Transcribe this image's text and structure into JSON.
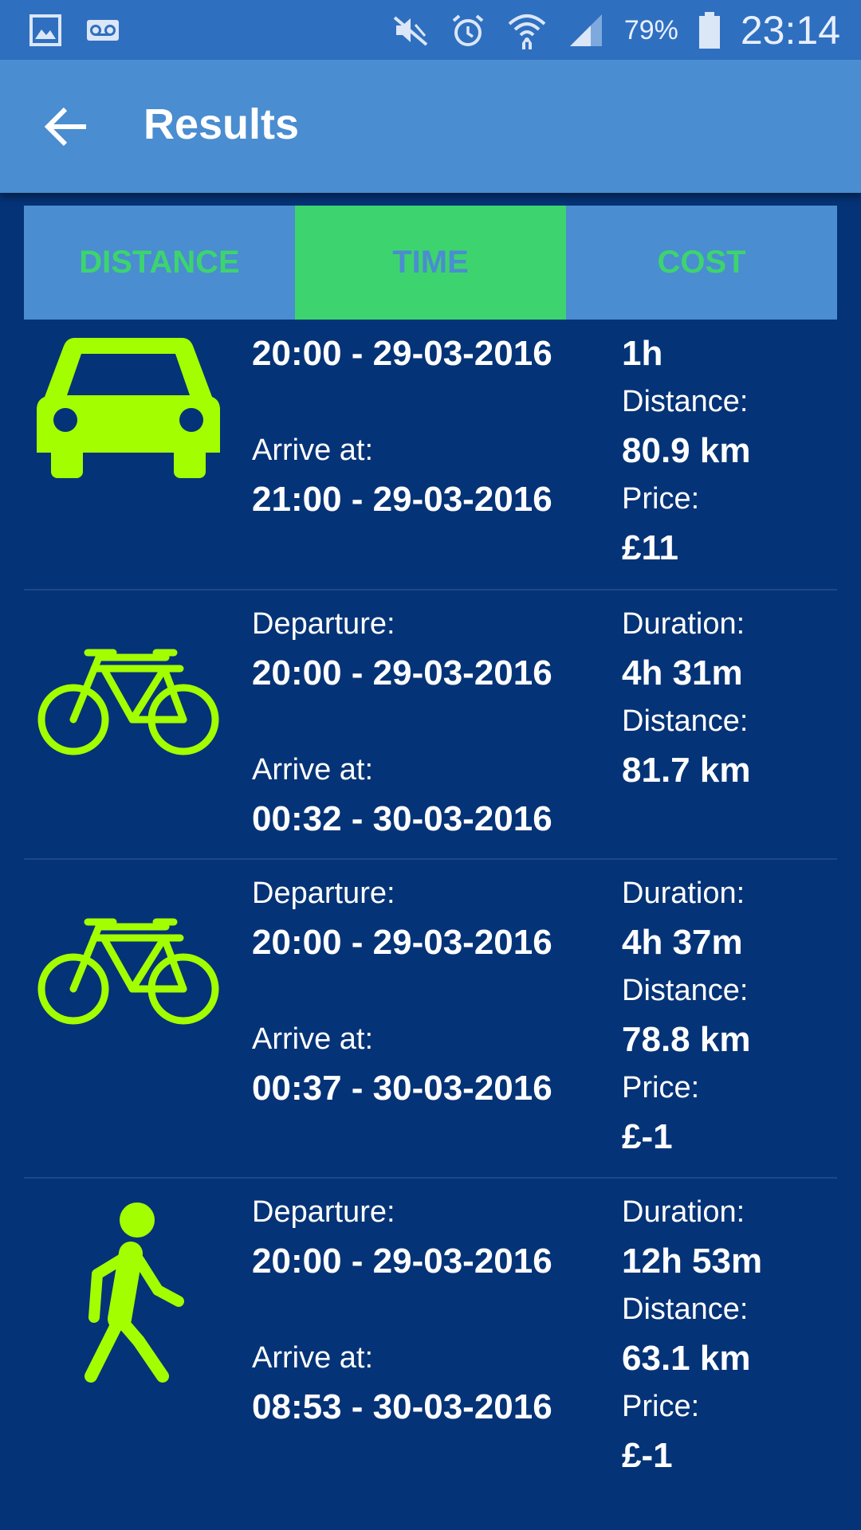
{
  "status_bar": {
    "battery": "79%",
    "time": "23:14"
  },
  "app_bar": {
    "title": "Results"
  },
  "tabs": [
    {
      "label": "DISTANCE",
      "active": false
    },
    {
      "label": "TIME",
      "active": true
    },
    {
      "label": "COST",
      "active": false
    }
  ],
  "results": [
    {
      "mode": "car",
      "icon": "car-icon",
      "departure_time": "20:00 - 29-03-2016",
      "arrive_label": "Arrive at:",
      "arrive_time": "21:00 - 29-03-2016",
      "duration": "1h",
      "distance_label": "Distance:",
      "distance": "80.9 km",
      "price_label": "Price:",
      "price": "£11"
    },
    {
      "mode": "bicycle",
      "icon": "bicycle-icon",
      "departure_label": "Departure:",
      "departure_time": "20:00 - 29-03-2016",
      "arrive_label": "Arrive at:",
      "arrive_time": "00:32 - 30-03-2016",
      "duration_label": "Duration:",
      "duration": "4h 31m",
      "distance_label": "Distance:",
      "distance": "81.7 km"
    },
    {
      "mode": "bicycle",
      "icon": "bicycle-icon",
      "departure_label": "Departure:",
      "departure_time": "20:00 - 29-03-2016",
      "arrive_label": "Arrive at:",
      "arrive_time": "00:37 - 30-03-2016",
      "duration_label": "Duration:",
      "duration": "4h 37m",
      "distance_label": "Distance:",
      "distance": "78.8 km",
      "price_label": "Price:",
      "price": "£-1"
    },
    {
      "mode": "walking",
      "icon": "walking-icon",
      "departure_label": "Departure:",
      "departure_time": "20:00 - 29-03-2016",
      "arrive_label": "Arrive at:",
      "arrive_time": "08:53 - 30-03-2016",
      "duration_label": "Duration:",
      "duration": "12h 53m",
      "distance_label": "Distance:",
      "distance": "63.1 km",
      "price_label": "Price:",
      "price": "£-1"
    }
  ],
  "colors": {
    "status_bar": "#2f6fbf",
    "app_bar": "#4a8dd0",
    "background": "#053377",
    "accent_green": "#3dd46f",
    "icon_lime": "#a3ff00"
  }
}
